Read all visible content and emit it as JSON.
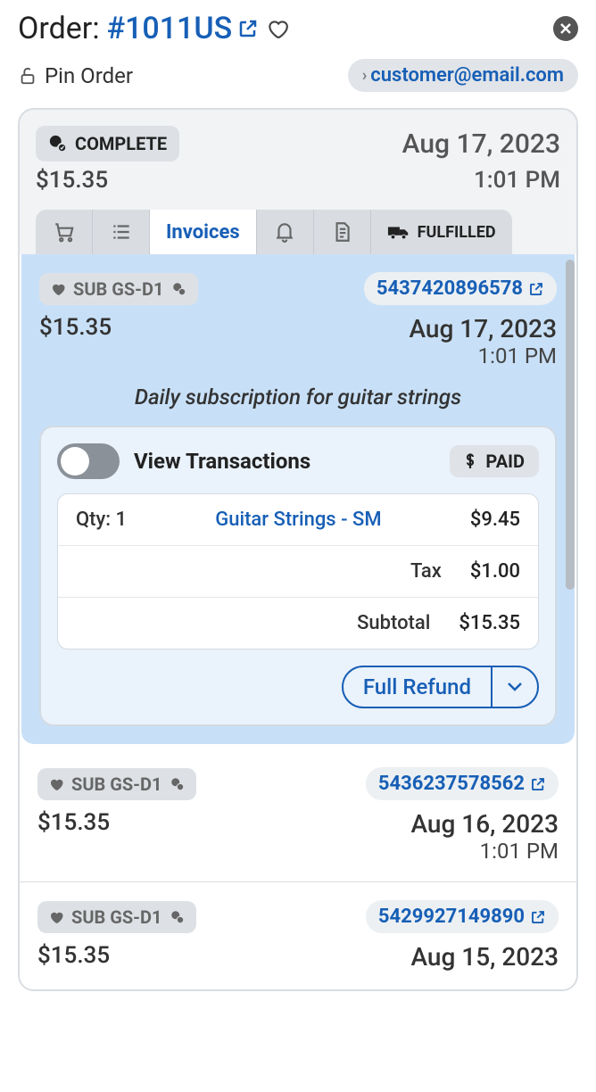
{
  "header": {
    "label": "Order:",
    "order_id": "#1011US",
    "pin_label": "Pin Order",
    "customer_email": "customer@email.com"
  },
  "summary": {
    "status": "COMPLETE",
    "date": "Aug 17, 2023",
    "amount": "$15.35",
    "time": "1:01 PM"
  },
  "tabs": {
    "invoices": "Invoices",
    "fulfilled": "FULFILLED"
  },
  "expanded_invoice": {
    "sub_label": "SUB GS-D1",
    "invoice_id": "5437420896578",
    "amount": "$15.35",
    "date": "Aug 17, 2023",
    "time": "1:01 PM",
    "description": "Daily subscription for guitar strings",
    "view_txn_label": "View Transactions",
    "paid_label": "PAID",
    "line_item": {
      "qty_label": "Qty: 1",
      "name": "Guitar Strings - SM",
      "price": "$9.45"
    },
    "tax_label": "Tax",
    "tax_value": "$1.00",
    "subtotal_label": "Subtotal",
    "subtotal_value": "$15.35",
    "refund_label": "Full Refund"
  },
  "invoices": [
    {
      "sub_label": "SUB GS-D1",
      "invoice_id": "5436237578562",
      "amount": "$15.35",
      "date": "Aug 16, 2023",
      "time": "1:01 PM"
    },
    {
      "sub_label": "SUB GS-D1",
      "invoice_id": "5429927149890",
      "amount": "$15.35",
      "date": "Aug 15, 2023",
      "time": ""
    }
  ]
}
